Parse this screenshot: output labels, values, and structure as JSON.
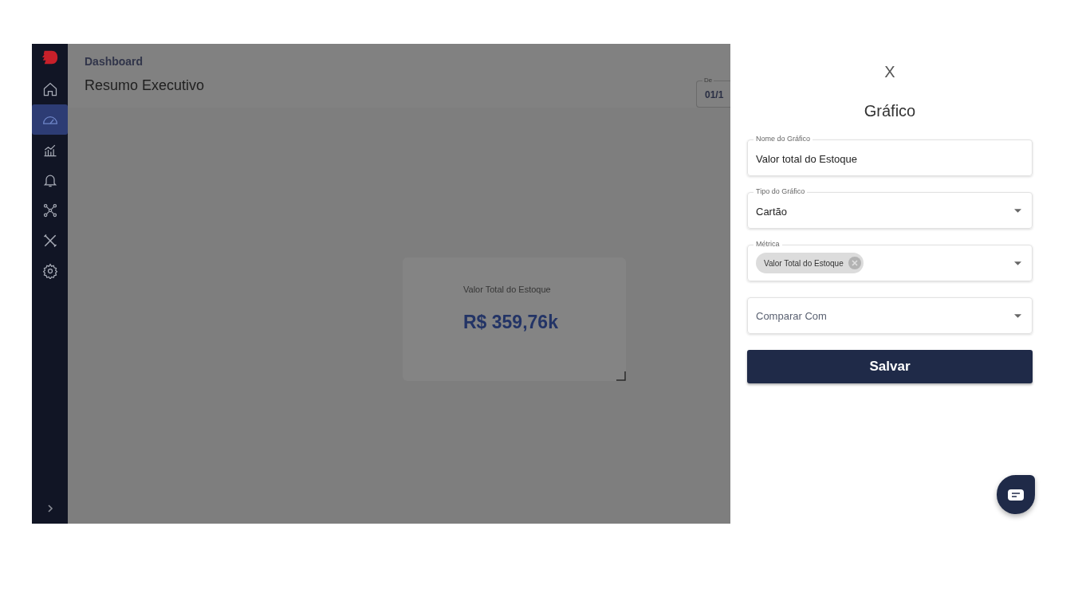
{
  "sidebar": {
    "items": [
      {
        "kind": "home",
        "selected": false
      },
      {
        "kind": "gauge",
        "selected": true
      },
      {
        "kind": "chart",
        "selected": false
      },
      {
        "kind": "bell",
        "selected": false
      },
      {
        "kind": "network",
        "selected": false
      },
      {
        "kind": "tools",
        "selected": false
      },
      {
        "kind": "settings",
        "selected": false
      }
    ]
  },
  "header": {
    "breadcrumb": "Dashboard",
    "title": "Resumo Executivo",
    "date_field": {
      "label": "De",
      "value": "01/1"
    }
  },
  "card": {
    "title": "Valor Total do Estoque",
    "value": "R$ 359,76k"
  },
  "drawer": {
    "close": "X",
    "title": "Gráfico",
    "fields": [
      {
        "kind": "text",
        "label": "Nome do Gráfico",
        "value": "Valor total do Estoque"
      },
      {
        "kind": "select",
        "label": "Tipo do Gráfico",
        "value": "Cartão"
      },
      {
        "kind": "chips",
        "label": "Métrica",
        "chips": [
          "Valor Total do Estoque"
        ]
      },
      {
        "kind": "select",
        "placeholder": "Comparar Com"
      }
    ],
    "button": "Salvar"
  }
}
